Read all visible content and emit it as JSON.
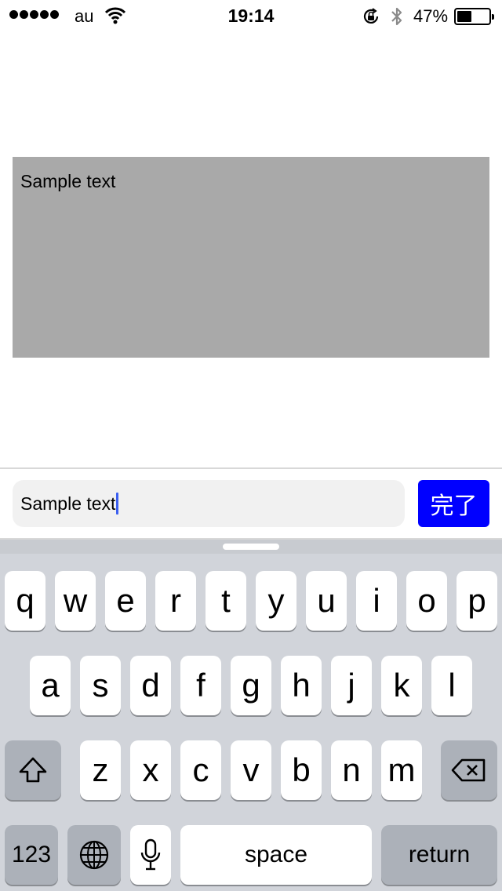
{
  "status_bar": {
    "carrier": "au",
    "time": "19:14",
    "battery_percent": "47%",
    "battery_level": 0.47,
    "icons": [
      "signal-dots-icon",
      "wifi-icon",
      "rotation-lock-icon",
      "bluetooth-icon",
      "battery-icon"
    ]
  },
  "text_view": {
    "text": "Sample text"
  },
  "input_bar": {
    "field_value": "Sample text",
    "done_label": "完了",
    "colors": {
      "done_button": "#0000ff",
      "text_view_bg": "#a9a9a9",
      "caret": "#3b5ff0"
    }
  },
  "keyboard": {
    "row1": [
      "q",
      "w",
      "e",
      "r",
      "t",
      "y",
      "u",
      "i",
      "o",
      "p"
    ],
    "row2": [
      "a",
      "s",
      "d",
      "f",
      "g",
      "h",
      "j",
      "k",
      "l"
    ],
    "row3": [
      "z",
      "x",
      "c",
      "v",
      "b",
      "n",
      "m"
    ],
    "numbers_label": "123",
    "space_label": "space",
    "return_label": "return",
    "icons": [
      "shift-icon",
      "backspace-icon",
      "globe-icon",
      "microphone-icon"
    ]
  }
}
